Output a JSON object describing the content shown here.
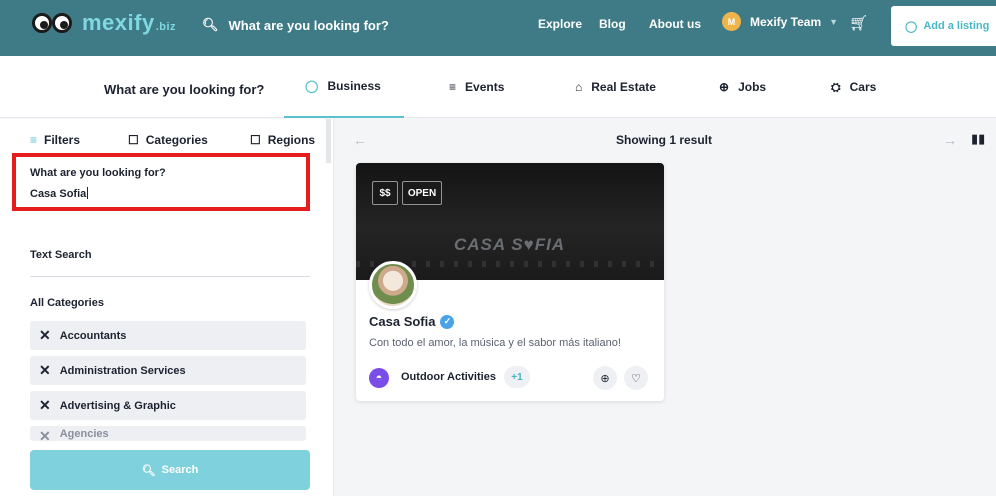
{
  "header": {
    "logo_text": "mexify",
    "logo_suffix": ".biz",
    "search_placeholder": "What are you looking for?",
    "nav": [
      "Explore",
      "Blog",
      "About us"
    ],
    "user_initial": "M",
    "user_name": "Mexify Team",
    "add_listing": "Add a listing"
  },
  "tabs": {
    "title": "What are you looking for?",
    "items": [
      {
        "label": "Business",
        "icon": "location-pin-icon"
      },
      {
        "label": "Events",
        "icon": "filter-lines-icon"
      },
      {
        "label": "Real Estate",
        "icon": "house-icon"
      },
      {
        "label": "Jobs",
        "icon": "search-zoom-icon"
      },
      {
        "label": "Cars",
        "icon": "car-icon"
      }
    ],
    "active": "Business"
  },
  "sidebar": {
    "tabs": [
      "Filters",
      "Categories",
      "Regions"
    ],
    "search_label": "What are you looking for?",
    "search_value": "Casa Sofia",
    "text_search": "Text Search",
    "all_categories": "All Categories",
    "categories": [
      "Accountants",
      "Administration Services",
      "Advertising & Graphic",
      "Agencies"
    ],
    "search_button": "Search"
  },
  "results": {
    "showing": "Showing 1 result"
  },
  "listing": {
    "price": "$$",
    "status": "OPEN",
    "cover_sign": "CASA S♥FIA",
    "title": "Casa Sofia",
    "description": "Con todo el amor, la música y el sabor más italiano!",
    "category": "Outdoor Activities",
    "more_categories": "+1"
  },
  "colors": {
    "header_bg": "#3f7b86",
    "accent": "#5bc3d0",
    "highlight_border": "#e51d1d",
    "category_icon": "#7a4de8"
  }
}
